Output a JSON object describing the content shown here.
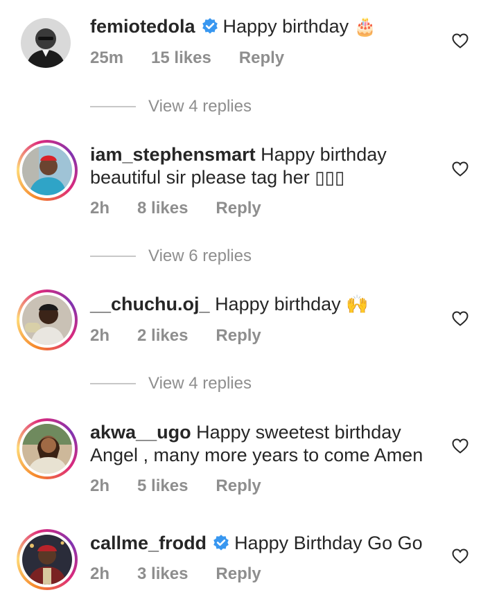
{
  "comments": [
    {
      "username": "femiotedola",
      "verified": true,
      "text": "Happy birthday",
      "emoji": "🎂",
      "time": "25m",
      "likes": "15 likes",
      "reply": "Reply",
      "view_replies": "View 4 replies"
    },
    {
      "username": "iam_stephensmart",
      "verified": false,
      "text": "Happy birthday beautiful sir please tag her",
      "emoji": "▯▯▯",
      "time": "2h",
      "likes": "8 likes",
      "reply": "Reply",
      "view_replies": "View 6 replies"
    },
    {
      "username": "__chuchu.oj_",
      "verified": false,
      "text": "Happy birthday",
      "emoji": "🙌",
      "time": "2h",
      "likes": "2 likes",
      "reply": "Reply",
      "view_replies": "View 4 replies"
    },
    {
      "username": "akwa__ugo",
      "verified": false,
      "text": "Happy sweetest birthday Angel , many more years to come Amen",
      "emoji": "",
      "time": "2h",
      "likes": "5 likes",
      "reply": "Reply"
    },
    {
      "username": "callme_frodd",
      "verified": true,
      "text": "Happy Birthday Go Go",
      "emoji": "",
      "time": "2h",
      "likes": "3 likes",
      "reply": "Reply"
    }
  ],
  "colors": {
    "text": "#262626",
    "muted": "#8e8e8e",
    "verified": "#3897f0",
    "divider": "#c7c7c7"
  },
  "icons": {
    "heart": "heart-outline-icon",
    "verified": "verified-badge-icon"
  }
}
